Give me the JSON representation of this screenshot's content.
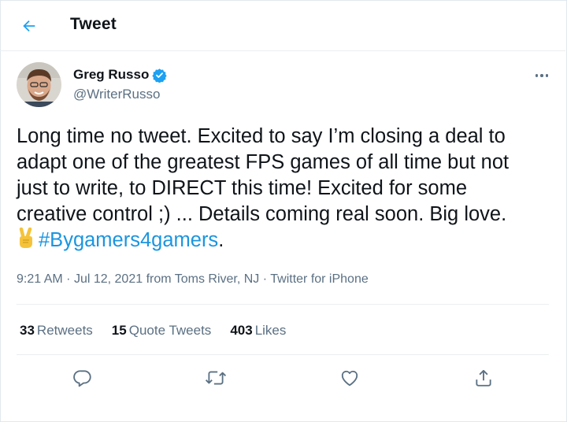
{
  "header": {
    "title": "Tweet",
    "back_icon": "back-arrow-icon"
  },
  "colors": {
    "accent": "#1da1f2",
    "hashtag": "#1b95e0",
    "muted": "#5b7083",
    "text": "#0f1419"
  },
  "tweet": {
    "author": {
      "name": "Greg Russo",
      "handle": "@WriterRusso",
      "verified": true
    },
    "text_main": "Long time no tweet. Excited to say I’m closing a deal to\nadapt one of the greatest FPS games of all time but not\njust to write, to DIRECT this time! Excited for some\ncreative control ;) ...  Details coming real soon. Big love.\n",
    "emoji": "victory-hand",
    "hashtag": "#Bygamers4gamers",
    "text_end": ".",
    "time": "9:21 AM",
    "date": "Jul 12, 2021",
    "location": "from Toms River, NJ",
    "source": "Twitter for iPhone",
    "sep": "·"
  },
  "stats": {
    "retweets": {
      "count": "33",
      "label": "Retweets"
    },
    "quotes": {
      "count": "15",
      "label": "Quote Tweets"
    },
    "likes": {
      "count": "403",
      "label": "Likes"
    }
  },
  "actions": [
    "reply-icon",
    "retweet-icon",
    "like-icon",
    "share-icon"
  ]
}
